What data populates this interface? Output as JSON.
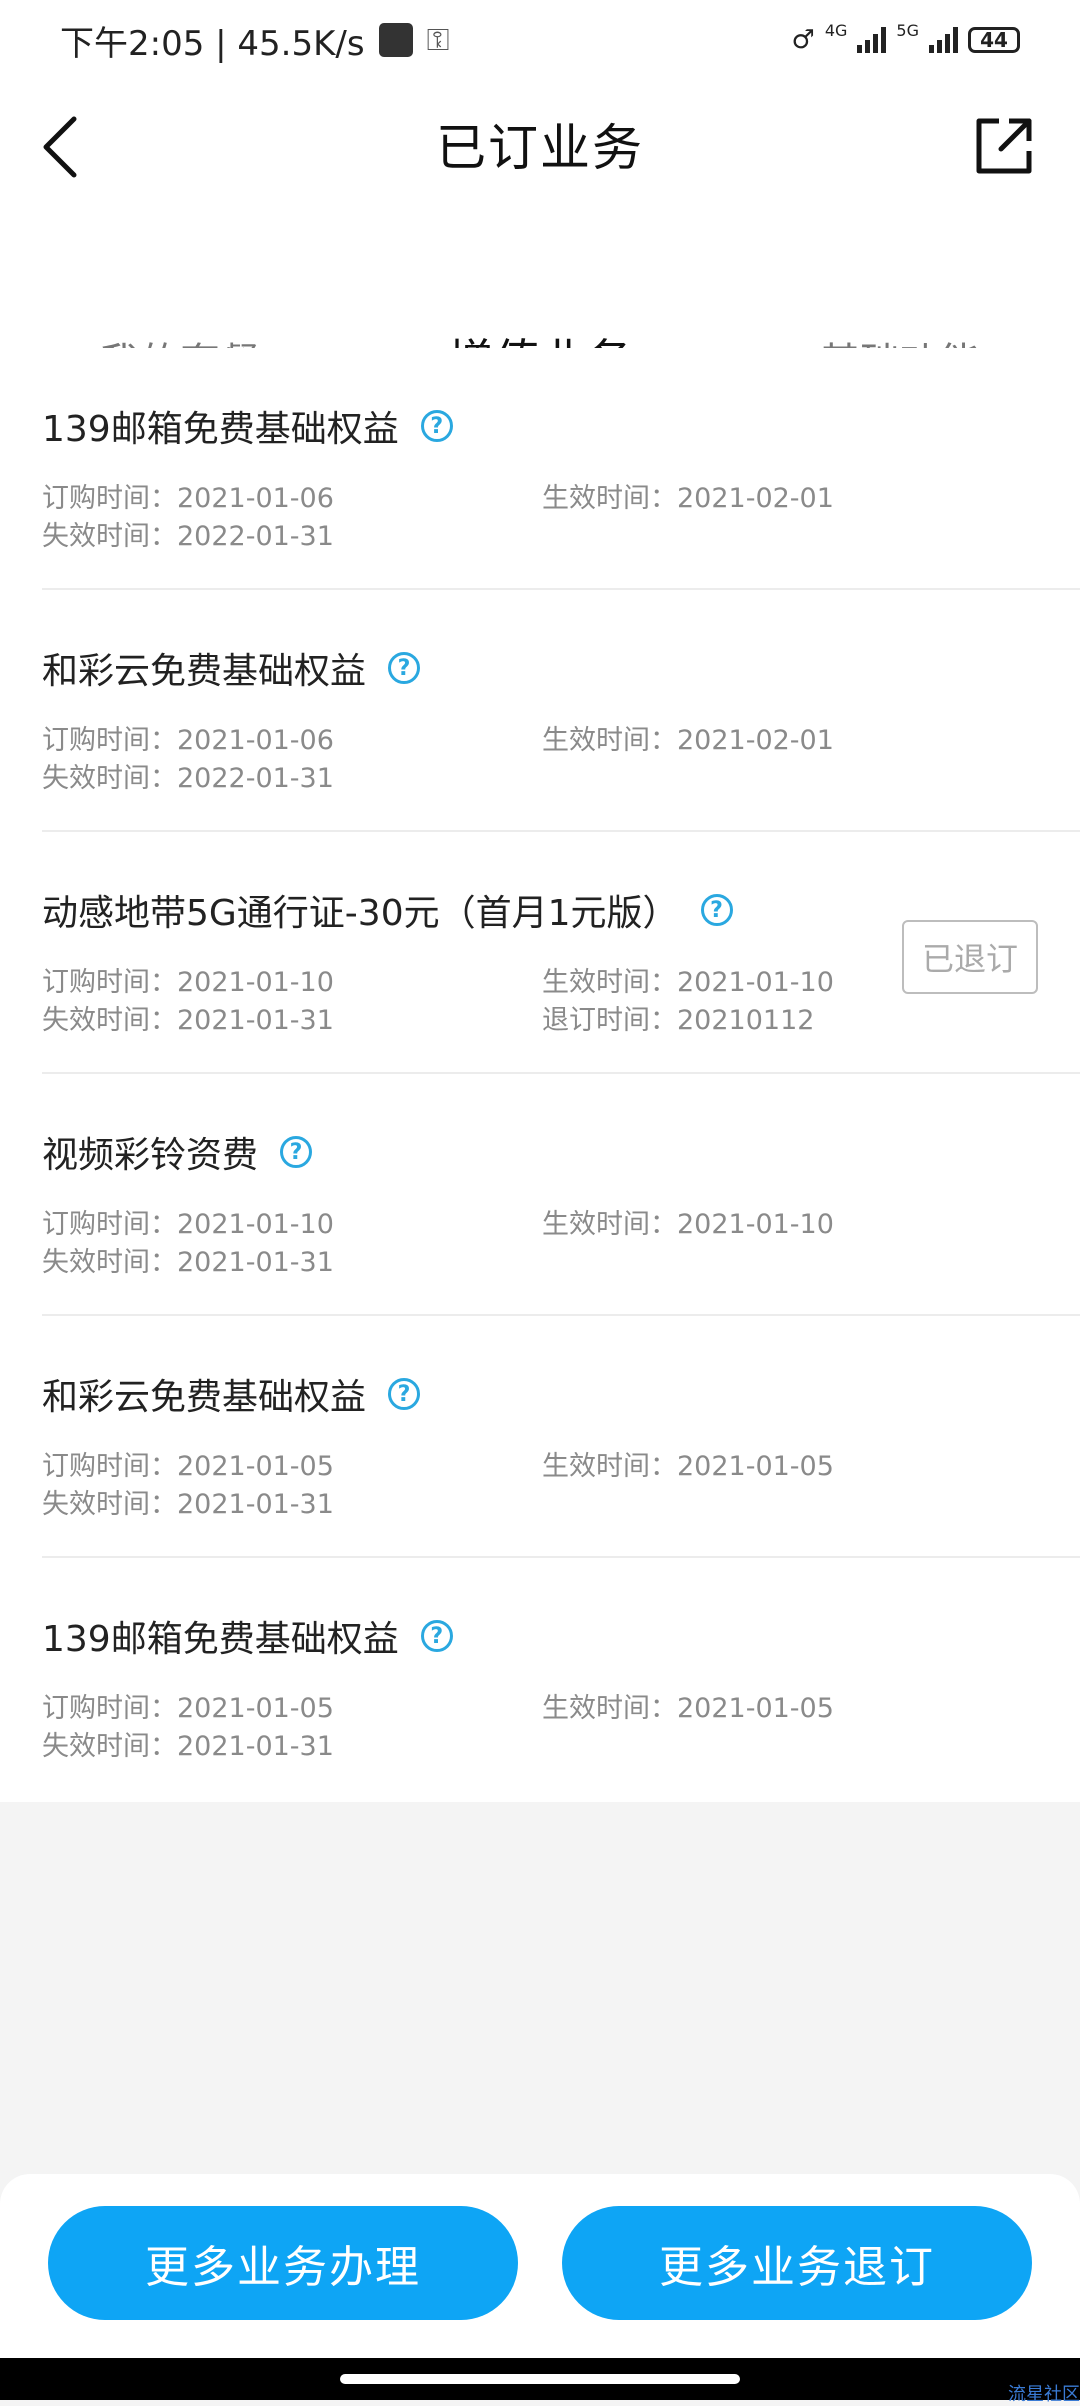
{
  "status_bar": {
    "time_speed": "下午2:05 | 45.5K/s",
    "net1": "4G",
    "net2": "5G",
    "battery": "44"
  },
  "header": {
    "title": "已订业务"
  },
  "tabs": [
    {
      "label": "我的套餐"
    },
    {
      "label": "增值业务"
    },
    {
      "label": "基础功能"
    }
  ],
  "items": [
    {
      "title": "139邮箱免费基础权益",
      "order_time": "订购时间：2021-01-06",
      "effective_time": "生效时间：2021-02-01",
      "expire_time": "失效时间：2022-01-31"
    },
    {
      "title": "和彩云免费基础权益",
      "order_time": "订购时间：2021-01-06",
      "effective_time": "生效时间：2021-02-01",
      "expire_time": "失效时间：2022-01-31"
    },
    {
      "title": "动感地带5G通行证-30元（首月1元版）",
      "order_time": "订购时间：2021-01-10",
      "effective_time": "生效时间：2021-01-10",
      "expire_time": "失效时间：2021-01-31",
      "unsub_time": "退订时间：20210112",
      "badge": "已退订"
    },
    {
      "title": "视频彩铃资费",
      "order_time": "订购时间：2021-01-10",
      "effective_time": "生效时间：2021-01-10",
      "expire_time": "失效时间：2021-01-31"
    },
    {
      "title": "和彩云免费基础权益",
      "order_time": "订购时间：2021-01-05",
      "effective_time": "生效时间：2021-01-05",
      "expire_time": "失效时间：2021-01-31"
    },
    {
      "title": "139邮箱免费基础权益",
      "order_time": "订购时间：2021-01-05",
      "effective_time": "生效时间：2021-01-05",
      "expire_time": "失效时间：2021-01-31"
    }
  ],
  "bottom": {
    "more_handle": "更多业务办理",
    "more_unsubscribe": "更多业务退订"
  },
  "watermark": "流星社区",
  "colors": {
    "accent_blue": "#0ea5f5",
    "help_icon": "#2aa8e0",
    "tab_gradient_start": "#e45ad2",
    "tab_gradient_end": "#9b5ee6"
  }
}
